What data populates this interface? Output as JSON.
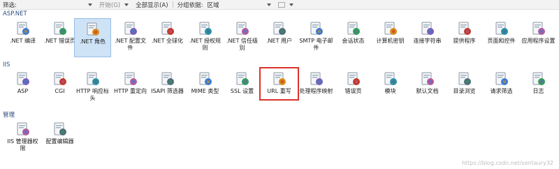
{
  "toolbar": {
    "filter_label": "筛选:",
    "go_label": "开始(G)",
    "show_all_label": "全部显示(A)",
    "group_by_label": "分组依据:",
    "group_value": "区域"
  },
  "sections": [
    {
      "title": "ASP.NET",
      "items": [
        {
          "label": ".NET 编译",
          "icon": "net-compilation-icon"
        },
        {
          "label": ".NET 错误页",
          "icon": "net-error-pages-icon"
        },
        {
          "label": ".NET 角色",
          "icon": "net-roles-icon"
        },
        {
          "label": ".NET 配置文件",
          "icon": "net-profile-icon"
        },
        {
          "label": ".NET 全球化",
          "icon": "net-globalization-icon"
        },
        {
          "label": ".NET 授权规则",
          "icon": "net-authorization-rules-icon"
        },
        {
          "label": ".NET 信任级别",
          "icon": "net-trust-levels-icon"
        },
        {
          "label": ".NET 用户",
          "icon": "net-users-icon"
        },
        {
          "label": "SMTP 电子邮件",
          "icon": "smtp-email-icon"
        },
        {
          "label": "会话状态",
          "icon": "session-state-icon"
        },
        {
          "label": "计算机密钥",
          "icon": "machine-key-icon"
        },
        {
          "label": "连接字符串",
          "icon": "connection-strings-icon"
        },
        {
          "label": "提供程序",
          "icon": "providers-icon"
        },
        {
          "label": "页面和控件",
          "icon": "pages-controls-icon"
        },
        {
          "label": "应用程序设置",
          "icon": "app-settings-icon"
        }
      ]
    },
    {
      "title": "IIS",
      "items": [
        {
          "label": "ASP",
          "icon": "asp-icon"
        },
        {
          "label": "CGI",
          "icon": "cgi-icon"
        },
        {
          "label": "HTTP 响应标头",
          "icon": "http-response-headers-icon"
        },
        {
          "label": "HTTP 重定向",
          "icon": "http-redirect-icon"
        },
        {
          "label": "ISAPI 筛选器",
          "icon": "isapi-filters-icon"
        },
        {
          "label": "MIME 类型",
          "icon": "mime-types-icon"
        },
        {
          "label": "SSL 设置",
          "icon": "ssl-settings-icon"
        },
        {
          "label": "URL 重写",
          "icon": "url-rewrite-icon"
        },
        {
          "label": "处理程序映射",
          "icon": "handler-mappings-icon"
        },
        {
          "label": "错误页",
          "icon": "error-pages-icon"
        },
        {
          "label": "模块",
          "icon": "modules-icon"
        },
        {
          "label": "默认文档",
          "icon": "default-document-icon"
        },
        {
          "label": "目录浏览",
          "icon": "directory-browsing-icon"
        },
        {
          "label": "请求筛选",
          "icon": "request-filtering-icon"
        },
        {
          "label": "日志",
          "icon": "logging-icon"
        }
      ]
    },
    {
      "title": "管理",
      "items": [
        {
          "label": "IIS 管理器权限",
          "icon": "iis-manager-permissions-icon"
        },
        {
          "label": "配置编辑器",
          "icon": "configuration-editor-icon"
        }
      ]
    }
  ],
  "watermark": "https://blog.csdn.net/sentaury32"
}
